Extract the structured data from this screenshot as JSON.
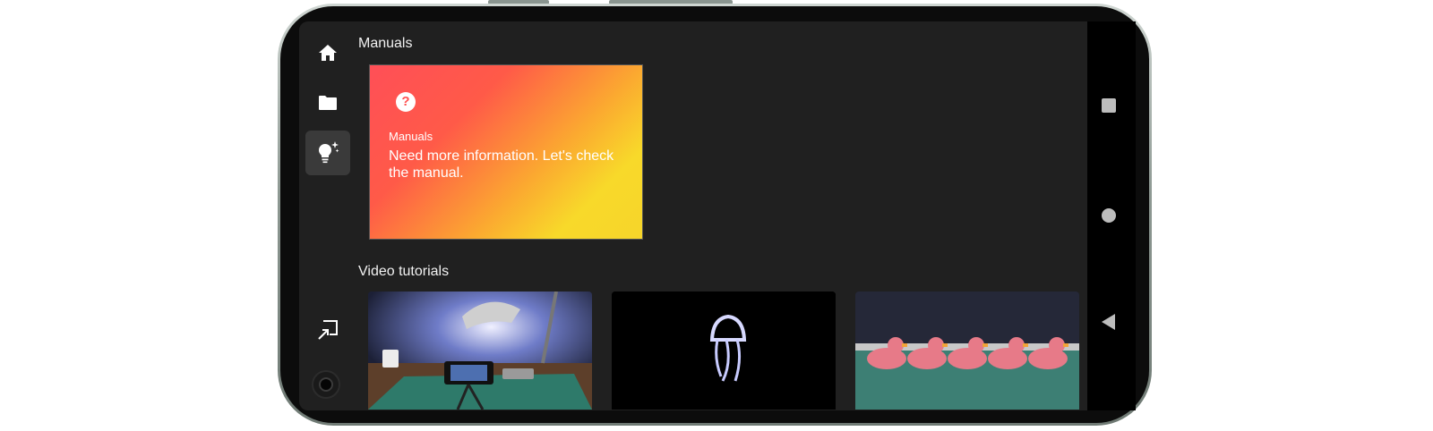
{
  "rail": {
    "items": [
      {
        "name": "home",
        "icon": "home-icon",
        "active": false
      },
      {
        "name": "files",
        "icon": "folder-icon",
        "active": false
      },
      {
        "name": "tips",
        "icon": "lightbulb-sparkle-icon",
        "active": true
      },
      {
        "name": "cast",
        "icon": "cast-arrow-icon",
        "active": false
      }
    ]
  },
  "manuals": {
    "section_title": "Manuals",
    "card": {
      "icon": "help-circle-icon",
      "label": "Manuals",
      "text": "Need more information. Let's check the manual.",
      "colors": [
        "#ff4f57",
        "#f6d52a"
      ]
    }
  },
  "videos": {
    "section_title": "Video tutorials",
    "items": [
      {
        "thumb": "desk-lamp-phone-tripod"
      },
      {
        "thumb": "light-painting-jellyfish"
      },
      {
        "thumb": "rubber-ducks-on-cutting-mat"
      }
    ]
  },
  "system_nav": [
    "recents-square",
    "home-circle",
    "back-triangle"
  ]
}
